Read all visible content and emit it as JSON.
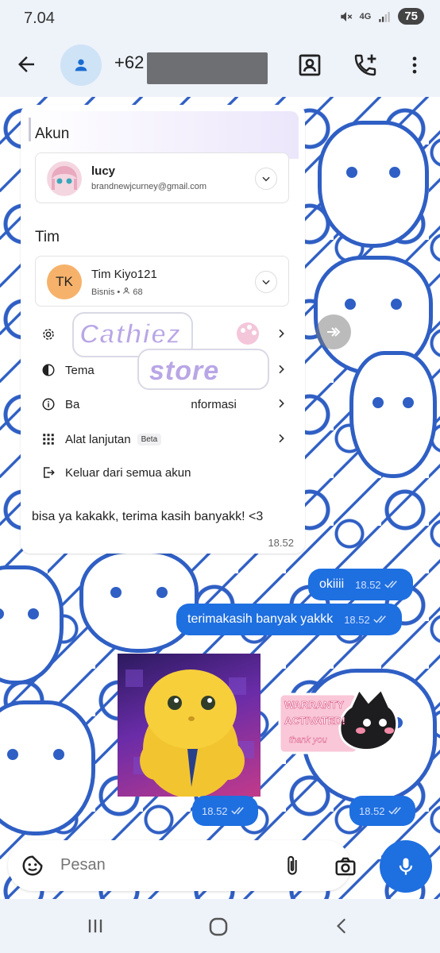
{
  "status": {
    "time": "7.04",
    "network": "4G",
    "battery": "75"
  },
  "header": {
    "phone_prefix": "+62"
  },
  "incoming": {
    "section_account": "Akun",
    "account": {
      "name": "lucy",
      "email": "brandnewjcurney@gmail.com"
    },
    "section_team": "Tim",
    "team": {
      "initials": "TK",
      "name": "Tim Kiyo121",
      "type": "Bisnis",
      "members": "68"
    },
    "menu": {
      "settings": "",
      "theme": "Tema",
      "help_prefix": "Ba",
      "help_suffix": "nformasi",
      "tools": "Alat lanjutan",
      "beta": "Beta",
      "logout": "Keluar dari semua akun"
    },
    "sticker_text_line1": "Cathiez",
    "sticker_text_line2": "store",
    "caption": "bisa ya kakakk, terima kasih banyakk! <3",
    "time": "18.52"
  },
  "outgoing": [
    {
      "text": "okiiii",
      "time": "18.52"
    },
    {
      "text": "terimakasih banyak yakkk",
      "time": "18.52"
    }
  ],
  "stickers": {
    "duck_time": "18.52",
    "cat_text1": "WARRANTY",
    "cat_text2": "ACTIVATED!",
    "cat_text3": "thank you",
    "cat_time": "18.52"
  },
  "composer": {
    "placeholder": "Pesan"
  },
  "colors": {
    "accent": "#1e6fe0",
    "wallpaper_ink": "#2f5fc4"
  }
}
